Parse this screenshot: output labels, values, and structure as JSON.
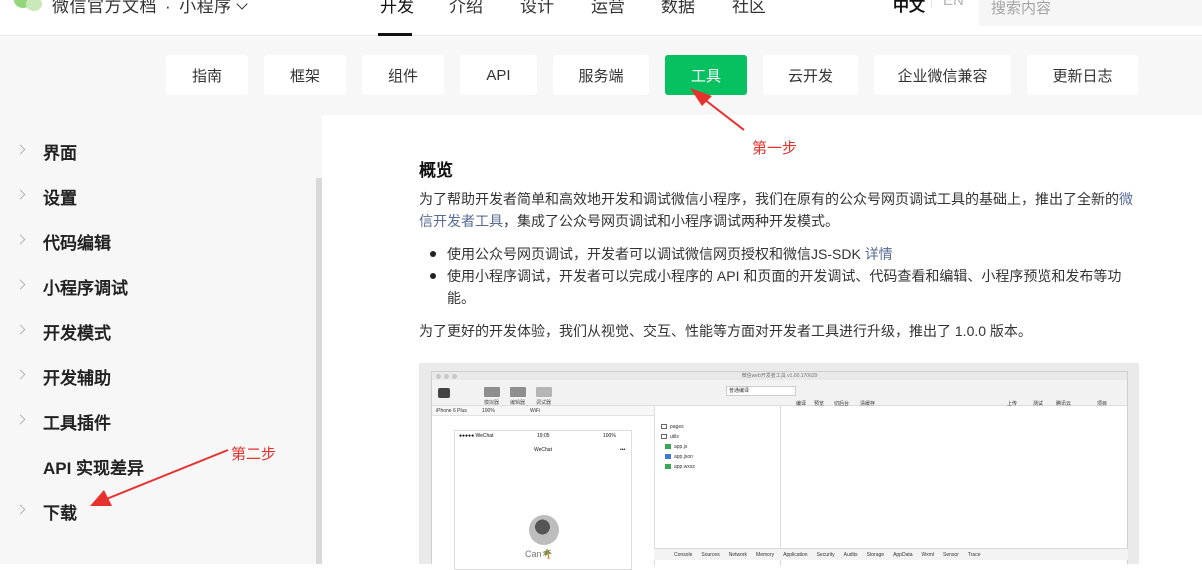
{
  "header": {
    "site_title": "微信官方文档",
    "dot": "·",
    "product": "小程序",
    "nav": [
      "开发",
      "介绍",
      "设计",
      "运营",
      "数据",
      "社区"
    ],
    "active_nav": "开发",
    "lang_zh": "中文",
    "lang_en": "EN",
    "search_placeholder": "搜索内容"
  },
  "subnav": {
    "items": [
      "指南",
      "框架",
      "组件",
      "API",
      "服务端",
      "工具",
      "云开发",
      "企业微信兼容",
      "更新日志"
    ],
    "active": "工具",
    "accent_color": "#07c160"
  },
  "sidebar": {
    "items": [
      "界面",
      "设置",
      "代码编辑",
      "小程序调试",
      "开发模式",
      "开发辅助",
      "工具插件",
      "API 实现差异",
      "下载"
    ]
  },
  "content": {
    "title": "概览",
    "p1_a": "为了帮助开发者简单和高效地开发和调试微信小程序，我们在原有的公众号网页调试工具的基础上，推出了全新的",
    "p1_link1": "微",
    "p1_link2": "信开发者工具",
    "p1_b": "，集成了公众号网页调试和小程序调试两种开发模式。",
    "bullet1": "使用公众号网页调试，开发者可以调试微信网页授权和微信JS-SDK",
    "bullet1_link": "详情",
    "bullet2_a": "使用小程序调试，开发者可以完成小程序的 API 和页面的开发调试、代码查看和编辑、小程序预览和发布等功",
    "bullet2_b": "能。",
    "p2": "为了更好的开发体验，我们从视觉、交互、性能等方面对开发者工具进行升级，推出了 1.0.0 版本。"
  },
  "ide_screenshot": {
    "title": "微信web开发者工具 v1.00.170629",
    "toolbar": [
      "模拟器",
      "编辑器",
      "调试器"
    ],
    "compile_mode": "普通编译",
    "toolbar_right": [
      "编译",
      "预览",
      "切后台",
      "清缓存"
    ],
    "toolbar_far_right": [
      "上传",
      "测试",
      "腾讯云",
      "项目"
    ],
    "device": "iPhone 6 Plus",
    "zoom": "100%",
    "network": "WiFi",
    "phone_carrier": "●●●●● WeChat",
    "phone_time": "19:05",
    "phone_battery": "100%",
    "phone_title": "WeChat",
    "phone_menu": "•••",
    "user": "Can",
    "files": [
      "pages",
      "utils",
      "app.js",
      "app.json",
      "app.wxss"
    ],
    "devtools_tabs": [
      "Console",
      "Sources",
      "Network",
      "Memory",
      "Application",
      "Security",
      "Audits",
      "Storage",
      "AppData",
      "Wxml",
      "Sensor",
      "Trace"
    ]
  },
  "annotations": {
    "step1": "第一步",
    "step2": "第二步",
    "color": "#e5322d"
  }
}
